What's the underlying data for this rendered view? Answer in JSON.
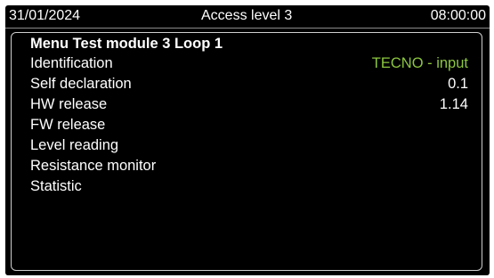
{
  "status_bar": {
    "date": "31/01/2024",
    "access_level": "Access level 3",
    "time": "08:00:00"
  },
  "menu": {
    "title": "Menu Test module 3 Loop 1",
    "items": [
      {
        "label": "Identification",
        "value": "TECNO - input"
      },
      {
        "label": "Self declaration",
        "value": "0.1"
      },
      {
        "label": "HW release",
        "value": "1.14"
      },
      {
        "label": "FW release",
        "value": ""
      },
      {
        "label": "Level reading",
        "value": ""
      },
      {
        "label": "Resistance monitor",
        "value": ""
      },
      {
        "label": "Statistic",
        "value": ""
      }
    ]
  },
  "colors": {
    "background": "#000000",
    "text": "#ffffff",
    "accent_value": "#8cc63f",
    "panel_border": "#cfcfcf"
  }
}
